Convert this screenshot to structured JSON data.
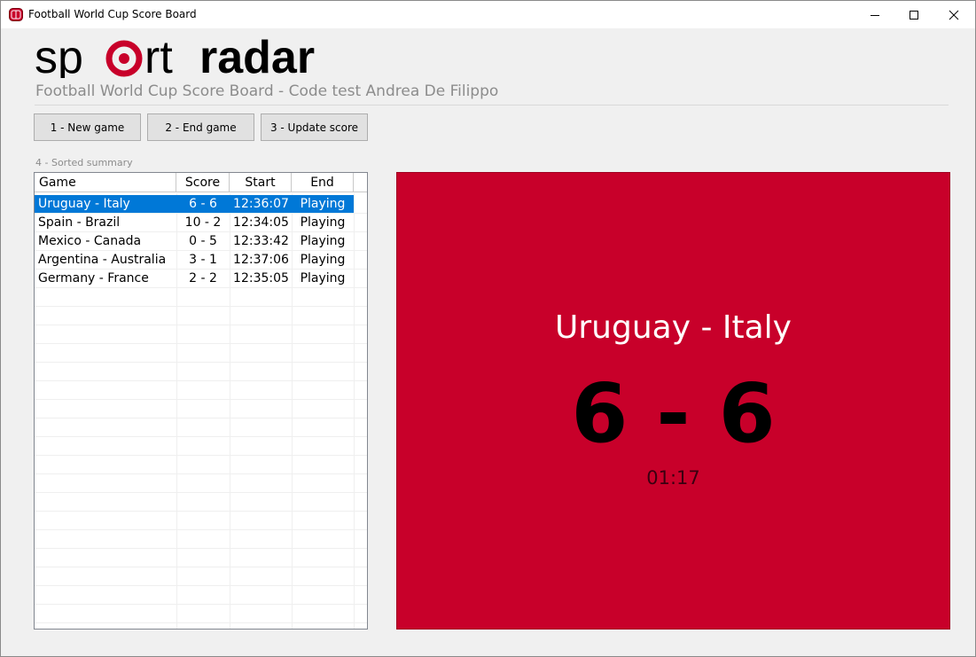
{
  "window": {
    "title": "Football World Cup Score Board",
    "icon": "football-icon"
  },
  "header": {
    "logo_text_light": "sp",
    "logo_text_light2": "rt",
    "logo_text_bold": "radar",
    "subtitle": "Football World Cup Score Board - Code test Andrea De Filippo"
  },
  "toolbar": {
    "new_game_label": "1 - New game",
    "end_game_label": "2 - End game",
    "update_score_label": "3 - Update score"
  },
  "summary": {
    "label": "4 - Sorted summary",
    "columns": [
      "Game",
      "Score",
      "Start",
      "End"
    ],
    "rows": [
      {
        "game": "Uruguay - Italy",
        "score": "6 - 6",
        "start": "12:36:07",
        "end": "Playing"
      },
      {
        "game": "Spain - Brazil",
        "score": "10 - 2",
        "start": "12:34:05",
        "end": "Playing"
      },
      {
        "game": "Mexico - Canada",
        "score": "0 - 5",
        "start": "12:33:42",
        "end": "Playing"
      },
      {
        "game": "Argentina - Australia",
        "score": "3 - 1",
        "start": "12:37:06",
        "end": "Playing"
      },
      {
        "game": "Germany - France",
        "score": "2 - 2",
        "start": "12:35:05",
        "end": "Playing"
      }
    ],
    "selected_index": 0
  },
  "scoreboard": {
    "game": "Uruguay - Italy",
    "score": "6 - 6",
    "elapsed": "01:17",
    "background_color": "#c8002a"
  },
  "colors": {
    "brand_red": "#c8002a",
    "selection_blue": "#0078d7"
  }
}
